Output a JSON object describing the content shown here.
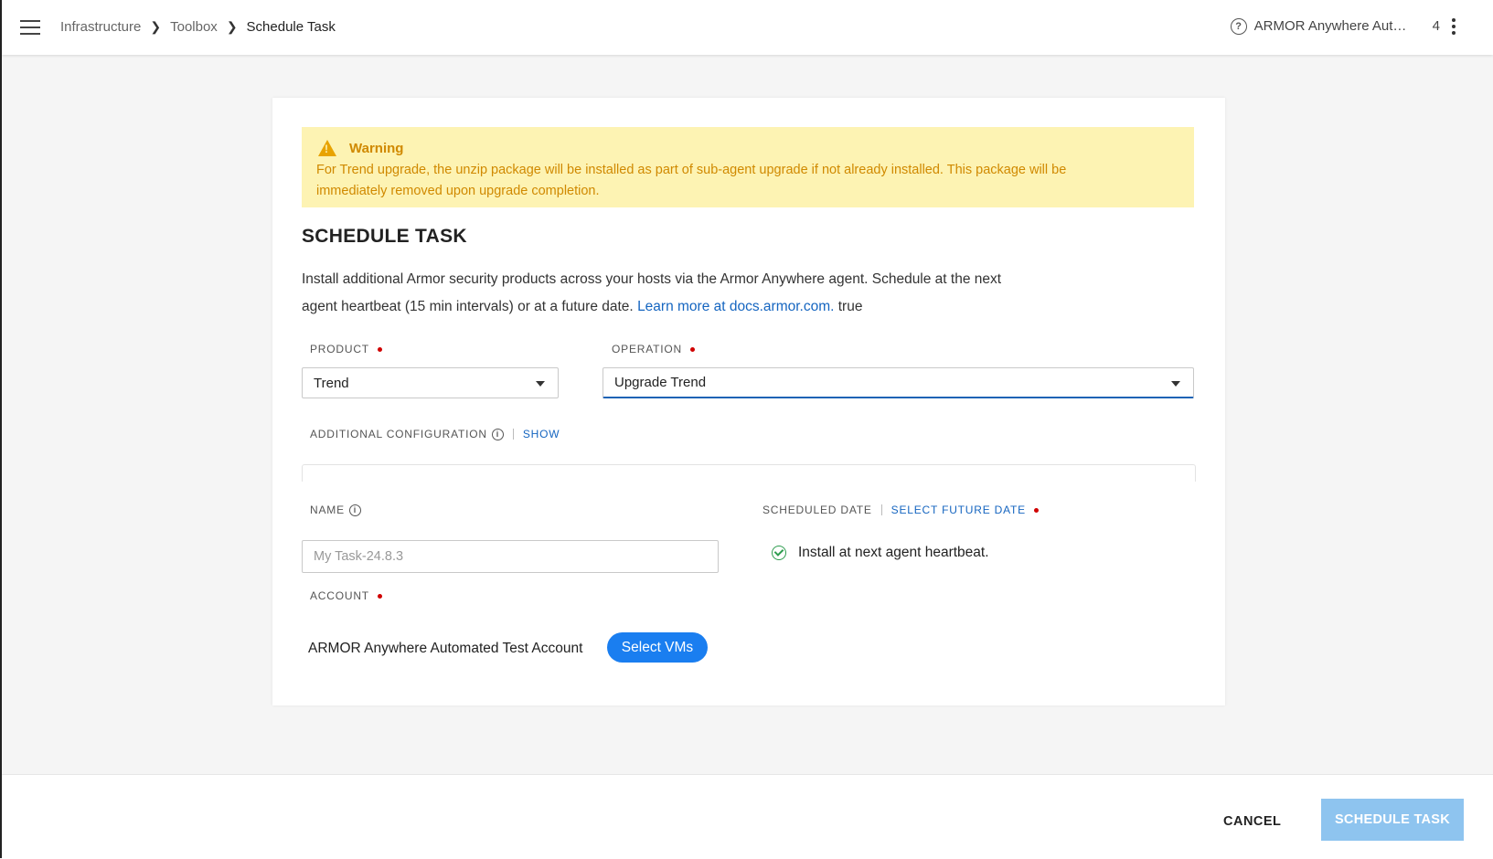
{
  "breadcrumb": {
    "items": [
      "Infrastructure",
      "Toolbox"
    ],
    "current": "Schedule Task"
  },
  "header": {
    "account": "ARMOR Anywhere Automated Test Account",
    "count": "4"
  },
  "warning": {
    "title": "Warning",
    "message": "For Trend upgrade, the unzip package will be installed as part of sub-agent upgrade if not already installed. This package will be immediately removed upon upgrade completion."
  },
  "form": {
    "title": "SCHEDULE TASK",
    "description": "Install additional Armor security products across your hosts via the Armor Anywhere agent. Schedule at the next agent heartbeat (15 min intervals) or at a future date.",
    "learn_more": "Learn more at docs.armor.com.",
    "trailing": "true",
    "product_label": "PRODUCT",
    "product_value": "Trend",
    "operation_label": "OPERATION",
    "operation_value": "Upgrade Trend",
    "additional_config_label": "ADDITIONAL CONFIGURATION",
    "show_label": "SHOW",
    "name_label": "NAME",
    "name_placeholder": "My Task-24.8.3",
    "scheduled_date_label": "SCHEDULED DATE",
    "select_future_date": "SELECT FUTURE DATE",
    "heartbeat_text": "Install at next agent heartbeat.",
    "account_label": "ACCOUNT",
    "account_value": "ARMOR Anywhere Automated Test Account",
    "select_vms": "Select VMs"
  },
  "footer": {
    "cancel": "CANCEL",
    "schedule": "SCHEDULE TASK"
  },
  "colors": {
    "accent": "#1565c0",
    "warning_bg": "#fdf3b3",
    "warning_text": "#d08900",
    "primary_button": "#1a7ef0",
    "disabled_button": "#8ec4ef",
    "required": "#d00000",
    "success": "#2e9d4f"
  }
}
